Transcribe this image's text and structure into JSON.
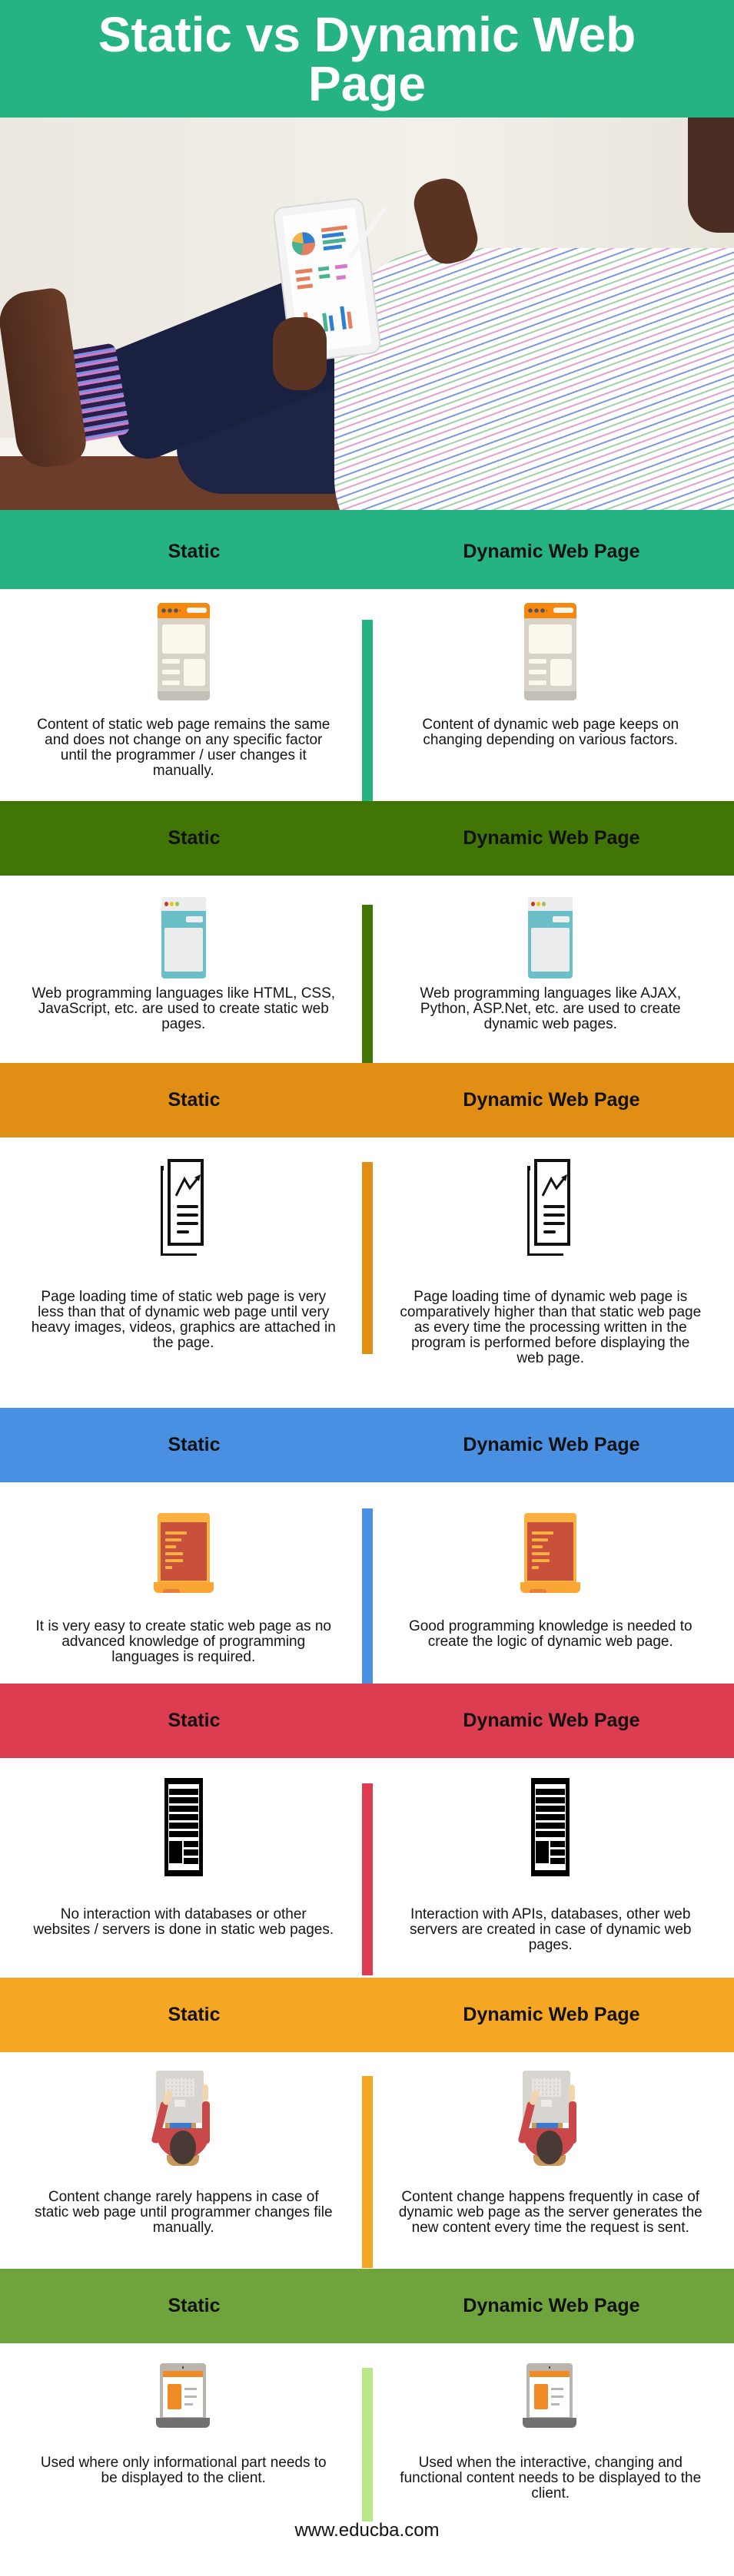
{
  "title": "Static vs Dynamic Web Page",
  "hero_image": {
    "icon": "man-with-tablet-photo",
    "description": "Person in striped shirt holding a tablet showing charts"
  },
  "sections": [
    {
      "header_static": "Static",
      "header_dynamic": "Dynamic Web Page",
      "color": "#25b383",
      "divider_color": "#25b383",
      "icon": "browser-window-icon",
      "static_text": "Content of static web page remains the same and does not change on any specific factor until the programmer / user changes it manually.",
      "dynamic_text": "Content of dynamic web page keeps on changing depending on various factors."
    },
    {
      "header_static": "Static",
      "header_dynamic": "Dynamic Web Page",
      "color": "#417505",
      "divider_color": "#417505",
      "icon": "app-window-icon",
      "static_text": "Web programming languages like HTML, CSS, JavaScript, etc. are used to create static web pages.",
      "dynamic_text": "Web programming languages like AJAX, Python, ASP.Net, etc. are used to create dynamic web pages."
    },
    {
      "header_static": "Static",
      "header_dynamic": "Dynamic Web Page",
      "color": "#e08e14",
      "divider_color": "#e08e14",
      "icon": "document-chart-icon",
      "static_text": "Page loading time of static web page is very less than that of dynamic web page until very heavy images, videos, graphics are attached in the page.",
      "dynamic_text": "Page loading time of dynamic web page is comparatively higher than that static web page as every time the processing written in the program is performed before displaying the web page."
    },
    {
      "header_static": "Static",
      "header_dynamic": "Dynamic Web Page",
      "color": "#4a90e2",
      "divider_color": "#4a90e2",
      "icon": "code-laptop-icon",
      "static_text": "It is very easy to create static web page as no advanced knowledge of programming languages is required.",
      "dynamic_text": "Good programming knowledge is needed to create the logic of dynamic web page."
    },
    {
      "header_static": "Static",
      "header_dynamic": "Dynamic Web Page",
      "color": "#dd3d51",
      "divider_color": "#dd3d51",
      "icon": "web-page-layout-icon",
      "static_text": "No interaction with databases or other websites / servers is done in static web pages.",
      "dynamic_text": "Interaction with APIs, databases, other web servers are created in case of dynamic web pages."
    },
    {
      "header_static": "Static",
      "header_dynamic": "Dynamic Web Page",
      "color": "#f5a623",
      "divider_color": "#f5a623",
      "icon": "programmer-at-desk-icon",
      "static_text": "Content change rarely happens in case of static web page until programmer changes file manually.",
      "dynamic_text": "Content change happens frequently in case of dynamic web page as the server generates the new content every time the request is sent."
    },
    {
      "header_static": "Static",
      "header_dynamic": "Dynamic Web Page",
      "color": "#6fa33c",
      "divider_color": "#b8e986",
      "icon": "laptop-website-icon",
      "static_text": "Used where only informational part needs to be displayed to the client.",
      "dynamic_text": "Used when the interactive, changing and functional content needs to be displayed to the client."
    }
  ],
  "footer": {
    "url": "www.educba.com"
  }
}
